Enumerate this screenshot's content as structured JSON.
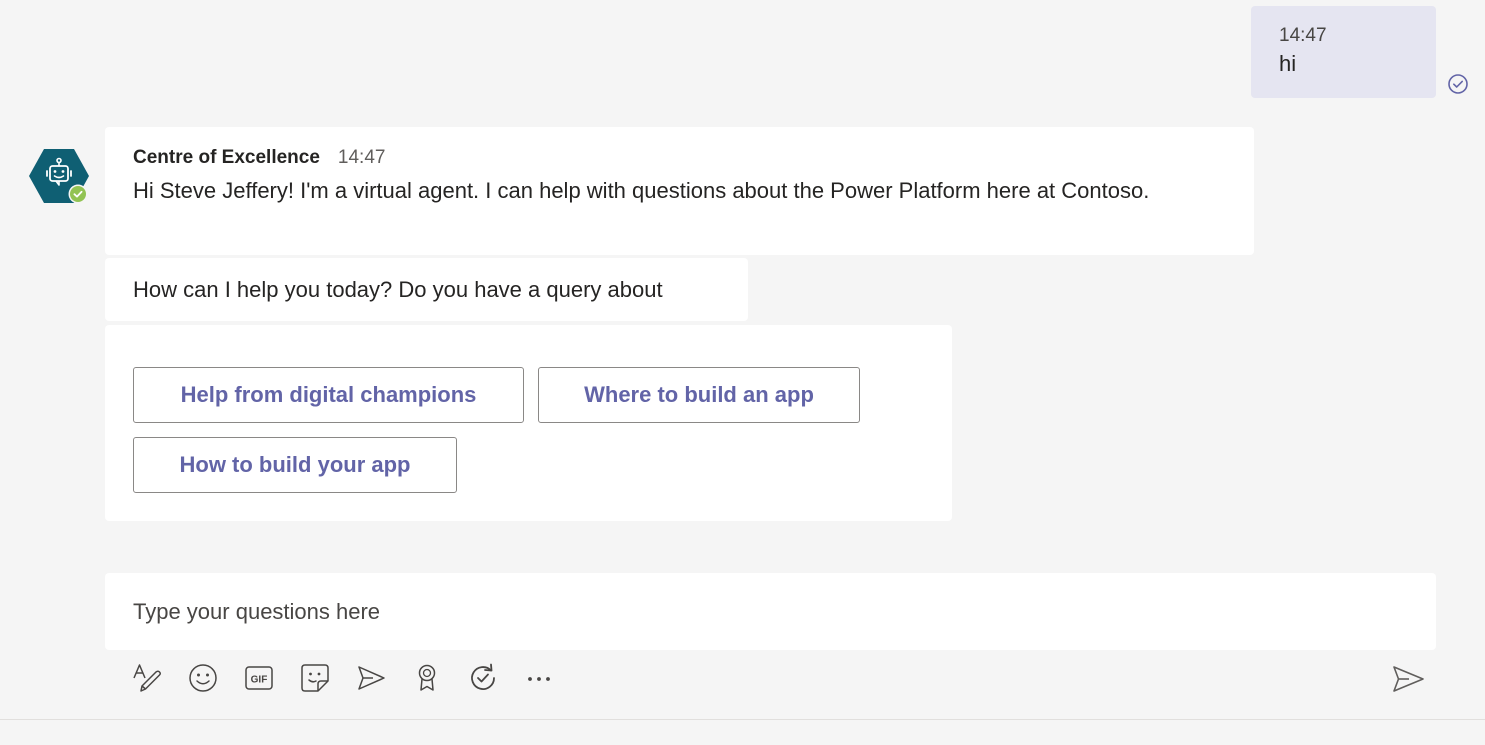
{
  "user_message": {
    "time": "14:47",
    "text": "hi"
  },
  "bot": {
    "name": "Centre of Excellence",
    "time": "14:47",
    "avatar_icon": "bot-icon",
    "status_icon": "available-check-icon",
    "greeting": "Hi Steve Jeffery! I'm a virtual agent. I can help with questions about the Power Platform here at Contoso.",
    "prompt": "How can I help you today? Do you have a query about",
    "choices": [
      "Help from digital champions",
      "Where to build an app",
      "How to build your app"
    ]
  },
  "compose": {
    "placeholder": "Type your questions here"
  },
  "toolbar": [
    {
      "icon": "format-icon"
    },
    {
      "icon": "emoji-icon"
    },
    {
      "icon": "gif-icon"
    },
    {
      "icon": "sticker-icon"
    },
    {
      "icon": "meet-now-icon"
    },
    {
      "icon": "praise-icon"
    },
    {
      "icon": "loop-icon"
    },
    {
      "icon": "more-options-icon"
    }
  ],
  "send_icon": "send-icon",
  "read_receipt_icon": "seen-check-icon",
  "colors": {
    "background": "#f5f5f5",
    "user_bubble": "#e5e5f1",
    "bot_bubble": "#ffffff",
    "accent": "#6264a7",
    "avatar": "#0f5f73",
    "presence": "#92c353"
  }
}
